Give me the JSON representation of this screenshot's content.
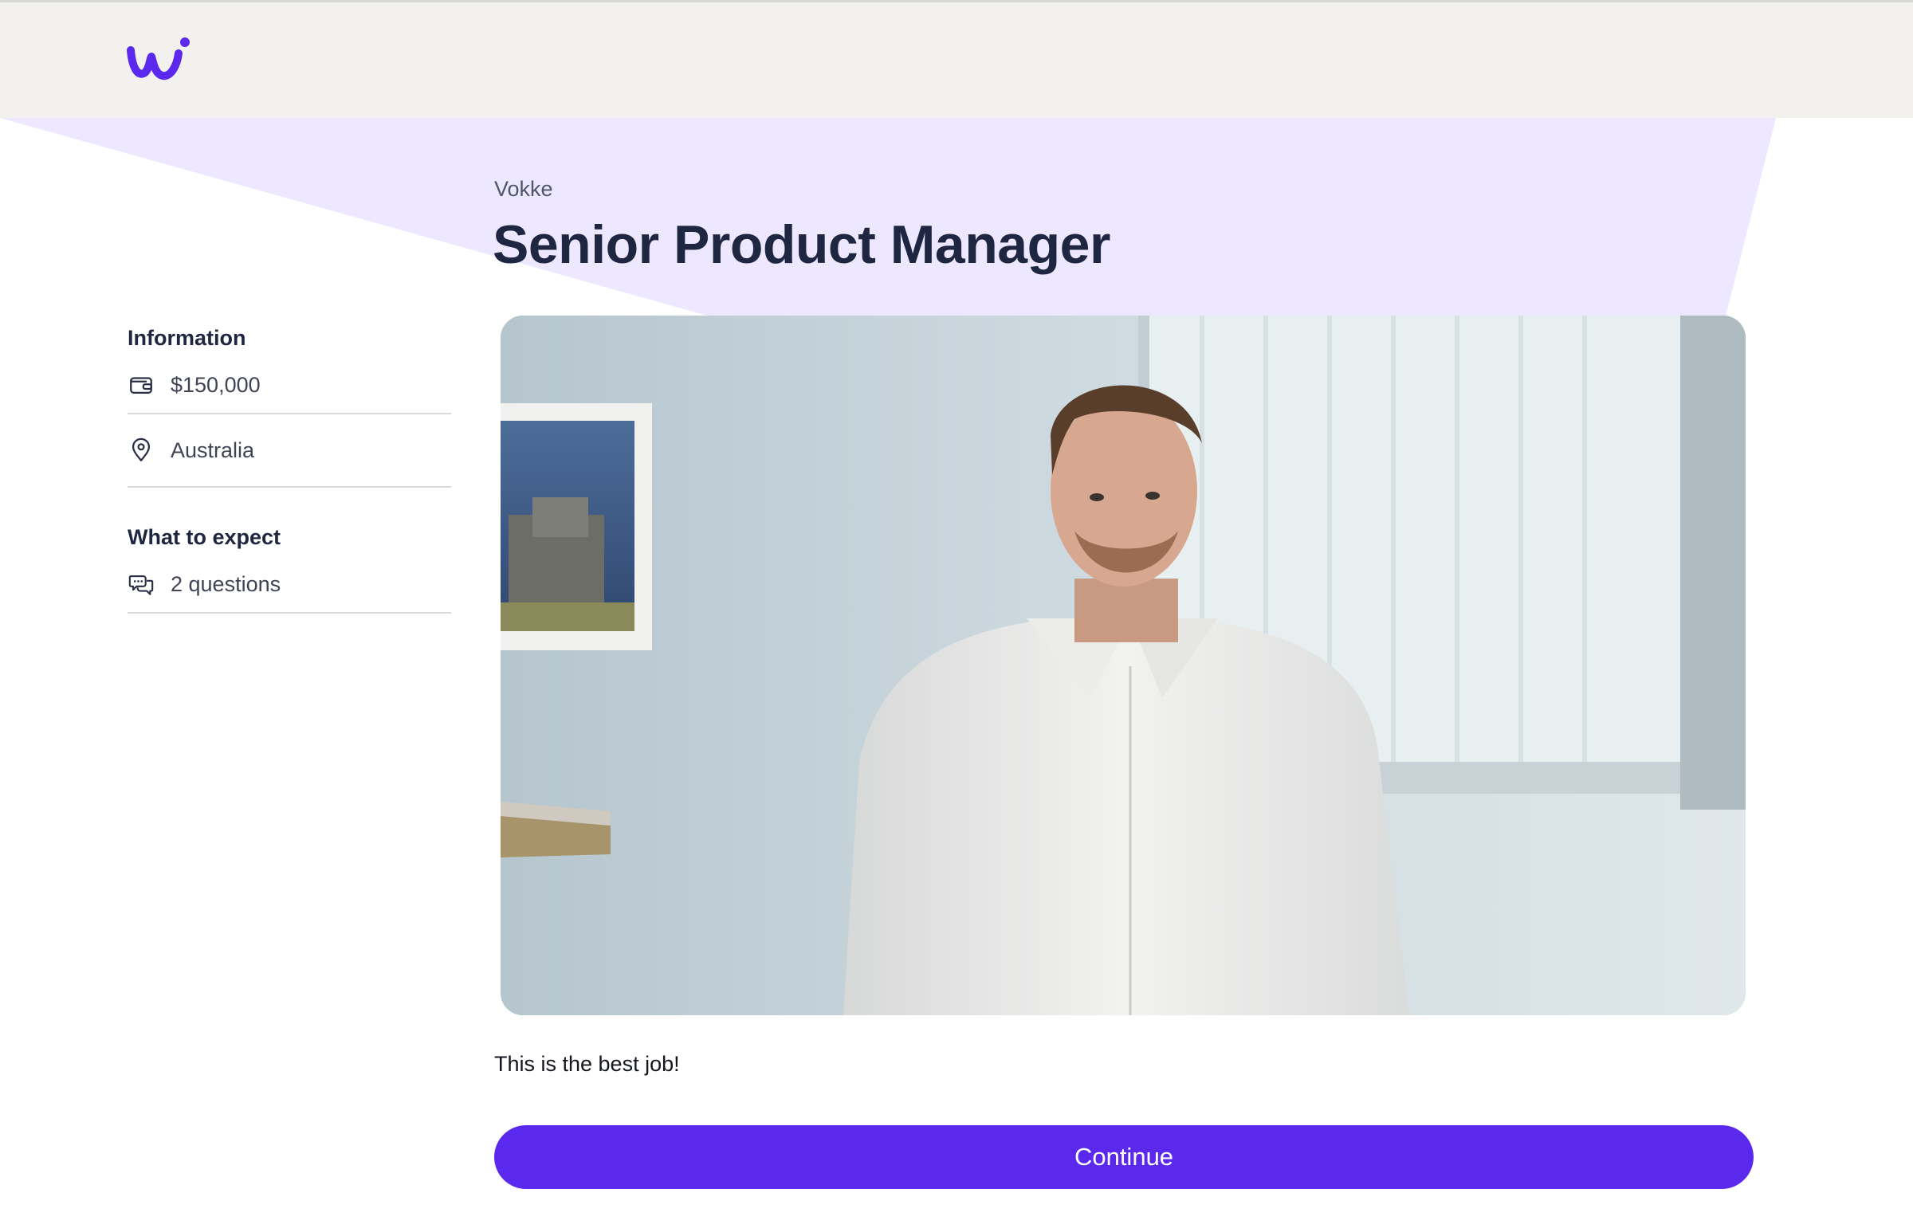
{
  "header": {
    "logo_icon": "wi-logo-icon",
    "brand_color": "#5b29ee"
  },
  "job": {
    "company": "Vokke",
    "title": "Senior Product Manager",
    "description": "This is the best job!"
  },
  "sidebar": {
    "information_title": "Information",
    "salary": {
      "icon": "wallet-icon",
      "text": "$150,000"
    },
    "location": {
      "icon": "location-pin-icon",
      "text": "Australia"
    },
    "expect_title": "What to expect",
    "questions": {
      "icon": "chat-bubbles-icon",
      "text": "2 questions"
    }
  },
  "video": {
    "icon": "video-poster-person"
  },
  "actions": {
    "continue_label": "Continue"
  }
}
